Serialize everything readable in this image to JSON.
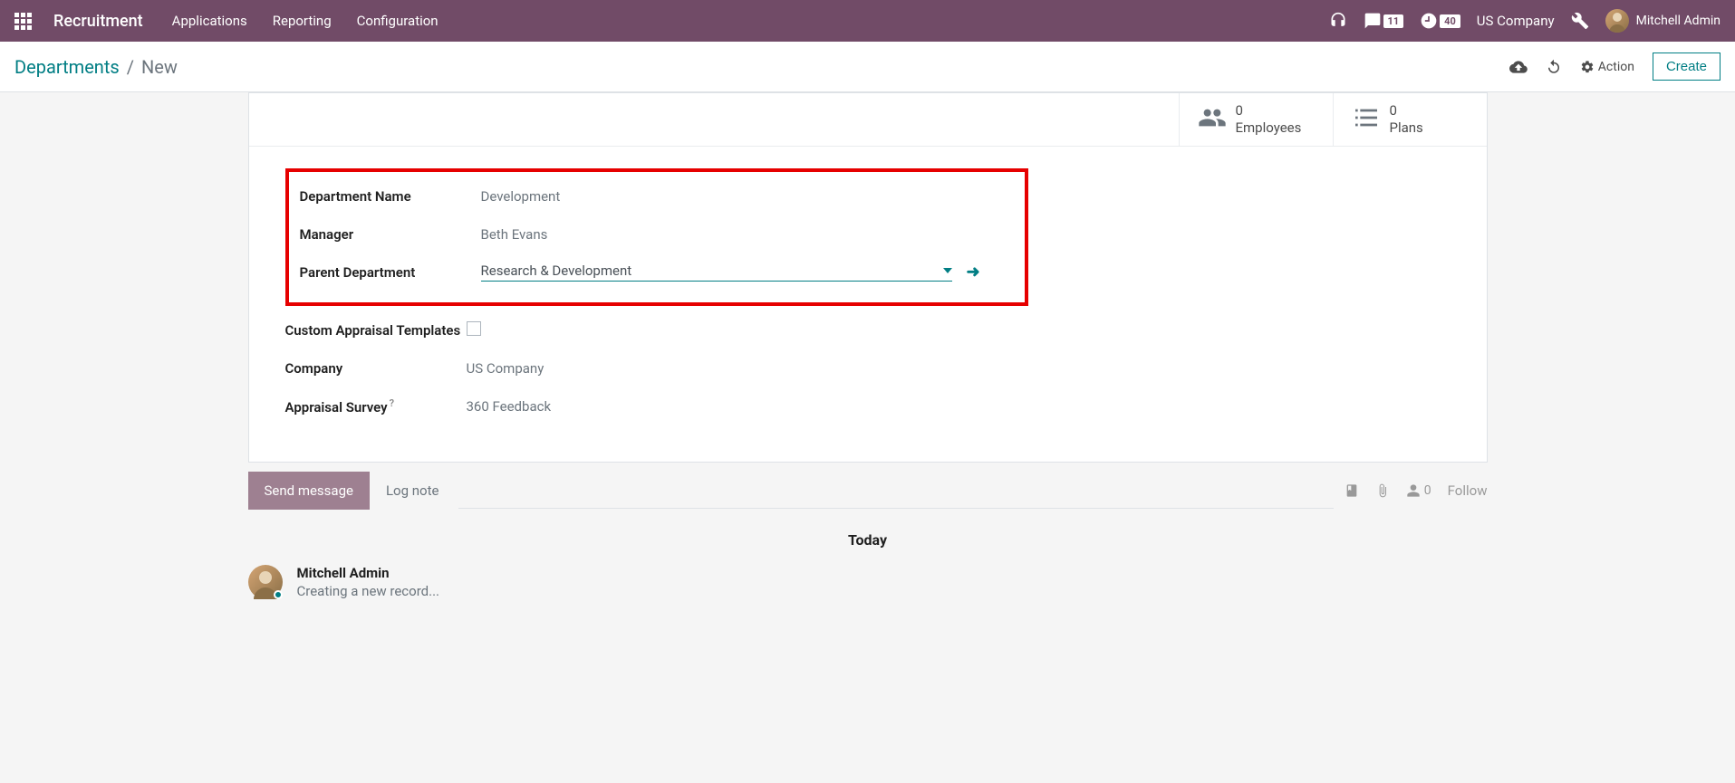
{
  "navbar": {
    "brand": "Recruitment",
    "menu": [
      "Applications",
      "Reporting",
      "Configuration"
    ],
    "messages_badge": "11",
    "activities_badge": "40",
    "company": "US Company",
    "user": "Mitchell Admin"
  },
  "control": {
    "breadcrumb_root": "Departments",
    "breadcrumb_current": "New",
    "action_label": "Action",
    "create_label": "Create"
  },
  "stats": {
    "employees_count": "0",
    "employees_label": "Employees",
    "plans_count": "0",
    "plans_label": "Plans"
  },
  "form": {
    "dept_name_label": "Department Name",
    "dept_name_value": "Development",
    "manager_label": "Manager",
    "manager_value": "Beth Evans",
    "parent_label": "Parent Department",
    "parent_value": "Research & Development",
    "appraisal_tpl_label": "Custom Appraisal Templates",
    "company_label": "Company",
    "company_value": "US Company",
    "survey_label": "Appraisal Survey",
    "survey_value": "360 Feedback"
  },
  "chatter": {
    "send_label": "Send message",
    "lognote_label": "Log note",
    "follower_count": "0",
    "follow_label": "Follow",
    "divider": "Today",
    "msg_author": "Mitchell Admin",
    "msg_text": "Creating a new record..."
  }
}
